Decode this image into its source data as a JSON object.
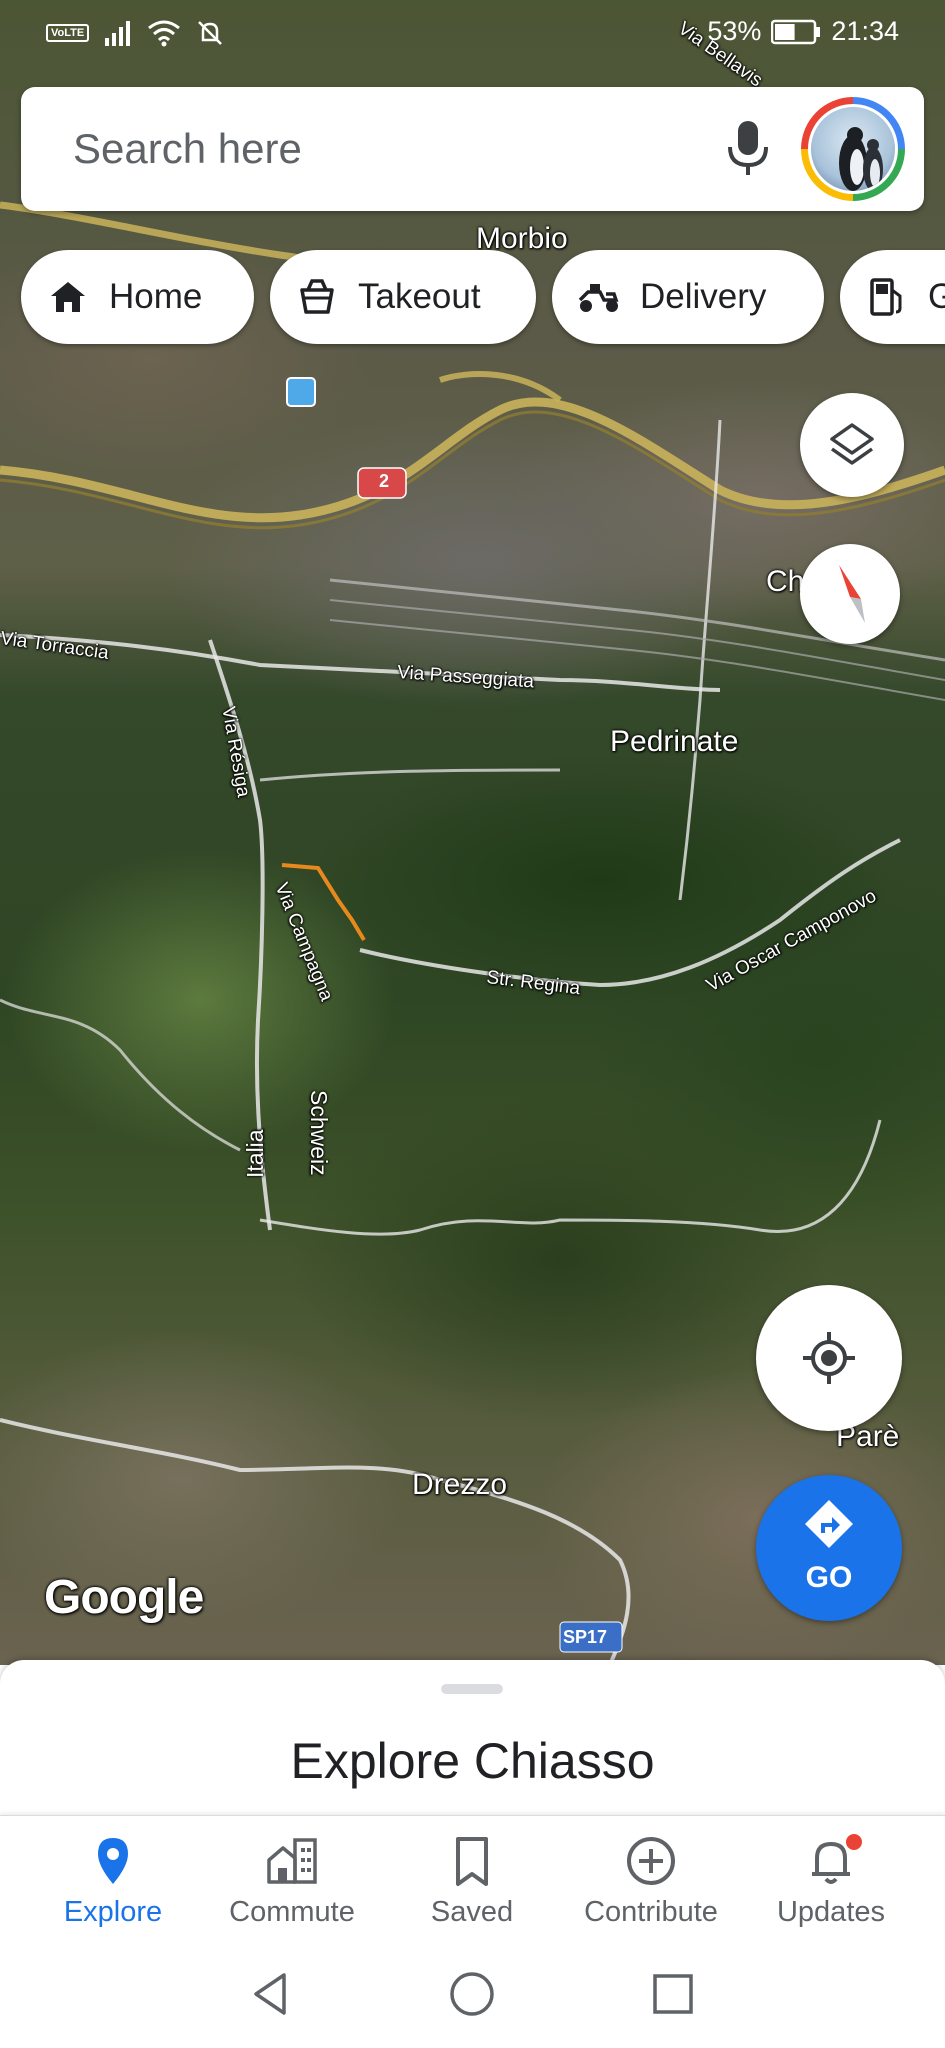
{
  "status_bar": {
    "network_badge": "VoLTE",
    "battery_percent": "53%",
    "time": "21:34",
    "battery_level": 0.53
  },
  "search": {
    "placeholder": "Search here"
  },
  "chips": [
    {
      "label": "Home",
      "icon": "home-icon"
    },
    {
      "label": "Takeout",
      "icon": "takeout-icon"
    },
    {
      "label": "Delivery",
      "icon": "delivery-icon"
    },
    {
      "label": "G",
      "icon": "gas-station-icon"
    }
  ],
  "map": {
    "labels": {
      "via_bellavista": "Via Bellavis",
      "morbio": "Morbio",
      "chiasso_partial": "Ch",
      "via_torraccia": "Via Torraccia",
      "via_passeggiata": "Via Passeggiata",
      "pedrinate": "Pedrinate",
      "via_resiga": "Via Résiga",
      "via_oscar_camponovo": "Via Oscar Camponovo",
      "via_campagna": "Via Campagna",
      "str_regina": "Str. Regina",
      "schweiz": "Schweiz",
      "italia": "Italia",
      "pare": "Parè",
      "drezzo": "Drezzo"
    },
    "shields": {
      "route_2": "2",
      "sp17": "SP17"
    },
    "attribution": "Google"
  },
  "go_button": {
    "label": "GO"
  },
  "bottom_sheet": {
    "title": "Explore Chiasso"
  },
  "bottom_nav": {
    "items": [
      {
        "label": "Explore",
        "icon": "explore-pin-icon",
        "active": true
      },
      {
        "label": "Commute",
        "icon": "commute-icon",
        "active": false
      },
      {
        "label": "Saved",
        "icon": "bookmark-icon",
        "active": false
      },
      {
        "label": "Contribute",
        "icon": "add-circle-icon",
        "active": false
      },
      {
        "label": "Updates",
        "icon": "bell-icon",
        "active": false
      }
    ]
  },
  "colors": {
    "accent": "#1a73e8",
    "notification": "#ea4335",
    "route_highlight": "#e8891c"
  }
}
